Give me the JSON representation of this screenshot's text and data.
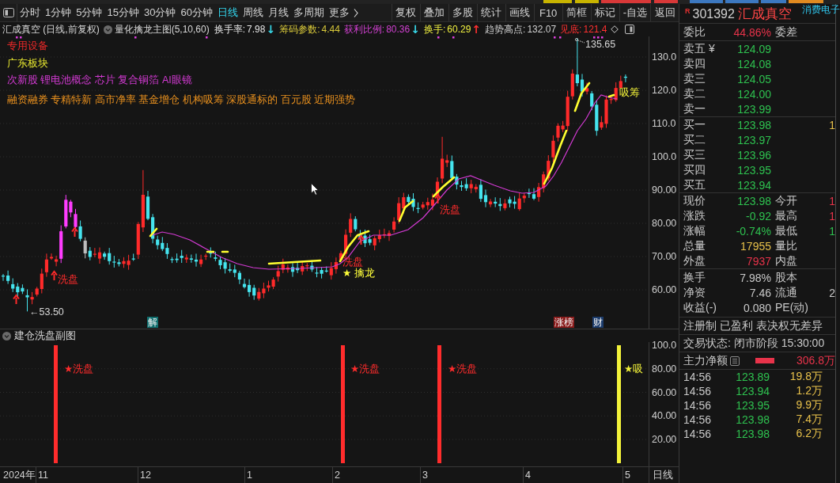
{
  "toolbar": {
    "periods": [
      {
        "label": "分时",
        "kind": "period",
        "selected": false
      },
      {
        "label": "1分钟",
        "kind": "period",
        "selected": false
      },
      {
        "label": "5分钟",
        "kind": "period",
        "selected": false
      },
      {
        "label": "15分钟",
        "kind": "period",
        "selected": false
      },
      {
        "label": "30分钟",
        "kind": "period",
        "selected": false
      },
      {
        "label": "60分钟",
        "kind": "period",
        "selected": false
      },
      {
        "label": "日线",
        "kind": "period",
        "selected": true
      },
      {
        "label": "周线",
        "kind": "period",
        "selected": false
      },
      {
        "label": "月线",
        "kind": "period",
        "selected": false
      },
      {
        "label": "多周期",
        "kind": "period",
        "selected": false
      },
      {
        "label": "更多",
        "kind": "menu",
        "selected": false
      }
    ],
    "tools": [
      "复权",
      "叠加",
      "多股",
      "统计",
      "画线",
      "F10",
      "简框",
      "标记",
      "-自选",
      "返回"
    ]
  },
  "chart_header": {
    "title": "汇成真空 (日线,前复权)",
    "indicator": "量化擒龙主图(5,10,60)",
    "readings": [
      {
        "label": "换手率:",
        "value": "7.98",
        "color": "#e6e6e6",
        "arrow": {
          "text": "↓",
          "color": "#38d8e8"
        }
      },
      {
        "label": "筹码参数:",
        "value": "4.44",
        "color": "#d8c83a"
      },
      {
        "label": "获利比例:",
        "value": "80.36",
        "color": "#d040d0",
        "arrow": {
          "text": "↓",
          "color": "#38d8e8"
        }
      },
      {
        "label": "换手:",
        "value": "60.29",
        "color": "#f0f040",
        "arrow": {
          "text": "↑",
          "color": "#ff3030"
        }
      },
      {
        "label": "趋势高点:",
        "value": "132.07",
        "color": "#d0d0d0"
      },
      {
        "label": "见底:",
        "value": "121.4",
        "color": "#ff3030"
      }
    ]
  },
  "price_chart": {
    "sectors": [
      {
        "text": "专用设备",
        "color": "#e82828"
      },
      {
        "text": "广东板块",
        "color": "#e8e830"
      },
      {
        "text": "次新股 锂电池概念 芯片 复合铜箔 AI眼镜",
        "color": "#d23ad2"
      },
      {
        "text": "融资融券 专精特新 高市净率 基金增仓 机构吸筹 深股通标的 百元股 近期强势",
        "color": "#e8901e"
      }
    ],
    "axis": [
      "130.0",
      "120.0",
      "110.0",
      "100.0",
      "90.00",
      "80.00",
      "70.00",
      "60.00"
    ],
    "high_label": "135.65",
    "low_label": "←53.50",
    "signals": [
      {
        "text": "洗盘",
        "kind": "wash"
      },
      {
        "text": "洗盘",
        "kind": "wash"
      },
      {
        "text": "★ 擒龙",
        "kind": "buy"
      },
      {
        "text": "洗盘",
        "kind": "wash"
      },
      {
        "text": "吸筹",
        "kind": "absorb"
      }
    ],
    "badges": [
      {
        "text": "解",
        "color": "#0f6e6e"
      },
      {
        "text": "涨榜",
        "color": "#8a1c1c"
      },
      {
        "text": "财",
        "color": "#1c3c6c"
      }
    ]
  },
  "sub_chart": {
    "title": "建仓洗盘副图",
    "axis": [
      "100.0",
      "80.00",
      "60.00",
      "40.00",
      "20.00"
    ],
    "signals": [
      {
        "text": "★洗盘",
        "kind": "wash"
      },
      {
        "text": "★洗盘",
        "kind": "wash"
      },
      {
        "text": "★洗盘",
        "kind": "wash"
      },
      {
        "text": "★吸",
        "kind": "absorb"
      }
    ]
  },
  "time_axis": {
    "labels": [
      "2024年",
      "11",
      "12",
      "1",
      "2",
      "3",
      "4",
      "5"
    ],
    "period": "日线"
  },
  "quote": {
    "badge": "R",
    "code": "301392",
    "name": "汇成真空",
    "sector": "消费电子",
    "ratio": {
      "label": "委比",
      "value": "44.86%",
      "label2": "委差"
    },
    "asks": [
      {
        "label": "卖五 ¥",
        "price": "124.09"
      },
      {
        "label": "卖四",
        "price": "124.08"
      },
      {
        "label": "卖三",
        "price": "124.05"
      },
      {
        "label": "卖二",
        "price": "124.00"
      },
      {
        "label": "卖一",
        "price": "123.99"
      }
    ],
    "bids": [
      {
        "label": "买一",
        "price": "123.98",
        "volume": "1"
      },
      {
        "label": "买二",
        "price": "123.97"
      },
      {
        "label": "买三",
        "price": "123.96"
      },
      {
        "label": "买四",
        "price": "123.95"
      },
      {
        "label": "买五",
        "price": "123.94"
      }
    ],
    "stats": [
      {
        "label": "现价",
        "value": "123.98",
        "color": "#2ec04f",
        "label2": "今开",
        "value2": {
          "text": "1",
          "color": "#e8334a"
        }
      },
      {
        "label": "涨跌",
        "value": "-0.92",
        "color": "#2ec04f",
        "label2": "最高",
        "value2": {
          "text": "1",
          "color": "#e8334a"
        }
      },
      {
        "label": "涨幅",
        "value": "-0.74%",
        "color": "#2ec04f",
        "label2": "最低",
        "value2": {
          "text": "1",
          "color": "#2ec04f"
        }
      },
      {
        "label": "总量",
        "value": "17955",
        "color": "#e8c14a",
        "label2": "量比"
      },
      {
        "label": "外盘",
        "value": "7937",
        "color": "#e8334a",
        "label2": "内盘"
      }
    ],
    "fundamentals": [
      {
        "label": "换手",
        "value": "7.98%",
        "label2": "股本"
      },
      {
        "label": "净资",
        "value": "7.46",
        "label2": "流通",
        "value2": "2"
      },
      {
        "label": "收益(-)",
        "value": "0.080",
        "label2": "PE(动)"
      }
    ],
    "tags": "注册制 已盈利 表决权无差异",
    "status": "交易状态: 闭市阶段 15:30:00",
    "main_flow": {
      "label": "主力净额",
      "value": "306.8万"
    },
    "ticks": [
      {
        "time": "14:56",
        "price": "123.89",
        "volume": "19.8万"
      },
      {
        "time": "14:56",
        "price": "123.94",
        "volume": "1.2万"
      },
      {
        "time": "14:56",
        "price": "123.95",
        "volume": "9.9万"
      },
      {
        "time": "14:56",
        "price": "123.98",
        "volume": "7.4万"
      },
      {
        "time": "14:56",
        "price": "123.98",
        "volume": "6.2万"
      }
    ]
  }
}
